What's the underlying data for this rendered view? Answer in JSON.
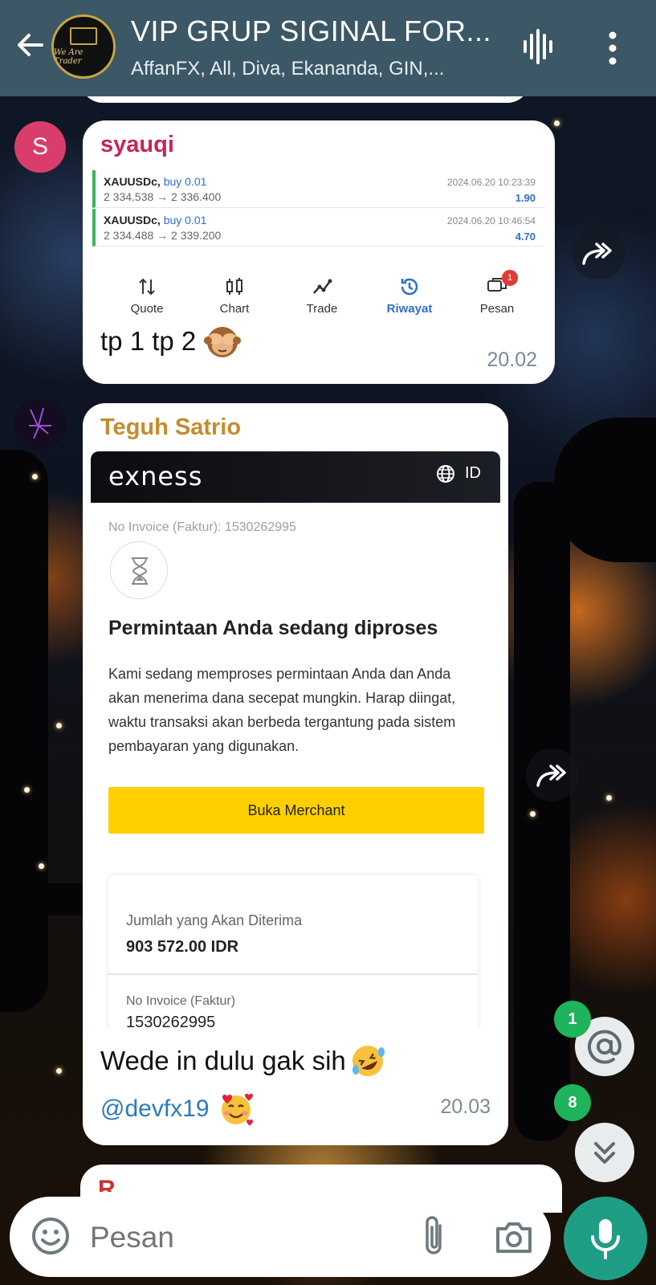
{
  "header": {
    "title": "VIP GRUP SIGINAL FOR...",
    "subtitle": "AffanFX, All, Diva, Ekananda, GIN,...",
    "avatar_text": "We Are Trader"
  },
  "messages": [
    {
      "sender": "syauqi",
      "avatar_letter": "S",
      "trades": [
        {
          "symbol": "XAUUSDc,",
          "side": "buy 0.01",
          "prices": "2 334.538 → 2 336.400",
          "datetime": "2024.06.20 10:23:39",
          "profit": "1.90"
        },
        {
          "symbol": "XAUUSDc,",
          "side": "buy 0.01",
          "prices": "2 334.488 → 2 339.200",
          "datetime": "2024.06.20 10:46:54",
          "profit": "4.70"
        }
      ],
      "tabs": [
        {
          "label": "Quote",
          "icon": "arrows-updown-icon"
        },
        {
          "label": "Chart",
          "icon": "candlestick-icon"
        },
        {
          "label": "Trade",
          "icon": "trend-line-icon"
        },
        {
          "label": "Riwayat",
          "icon": "history-icon"
        },
        {
          "label": "Pesan",
          "icon": "messages-icon",
          "badge": "1"
        }
      ],
      "text": "tp 1 tp 2",
      "time": "20.02"
    },
    {
      "sender": "Teguh Satrio",
      "screenshot": {
        "brand": "exness",
        "lang": "ID",
        "invoice_line": "No Invoice (Faktur): 1530262995",
        "title": "Permintaan Anda sedang diproses",
        "body": "Kami sedang memproses permintaan Anda dan Anda akan menerima dana secepat mungkin. Harap diingat, waktu transaksi akan berbeda tergantung pada sistem pembayaran yang digunakan.",
        "button": "Buka Merchant",
        "amount_label": "Jumlah yang Akan Diterima",
        "amount_value": "903 572.00 IDR",
        "invoice_label": "No Invoice (Faktur)",
        "invoice_value": "1530262995"
      },
      "text": "Wede in dulu gak sih",
      "mention": "@devfx19",
      "time": "20.03"
    }
  ],
  "next_sender_initial": "R",
  "badges": {
    "mentions": "1",
    "unread": "8"
  },
  "input": {
    "placeholder": "Pesan"
  },
  "colors": {
    "header": "#3c5765",
    "accent_green": "#1f9e86",
    "badge_green": "#1fb35b",
    "sender1": "#c5265a",
    "sender2": "#c68b2d"
  }
}
